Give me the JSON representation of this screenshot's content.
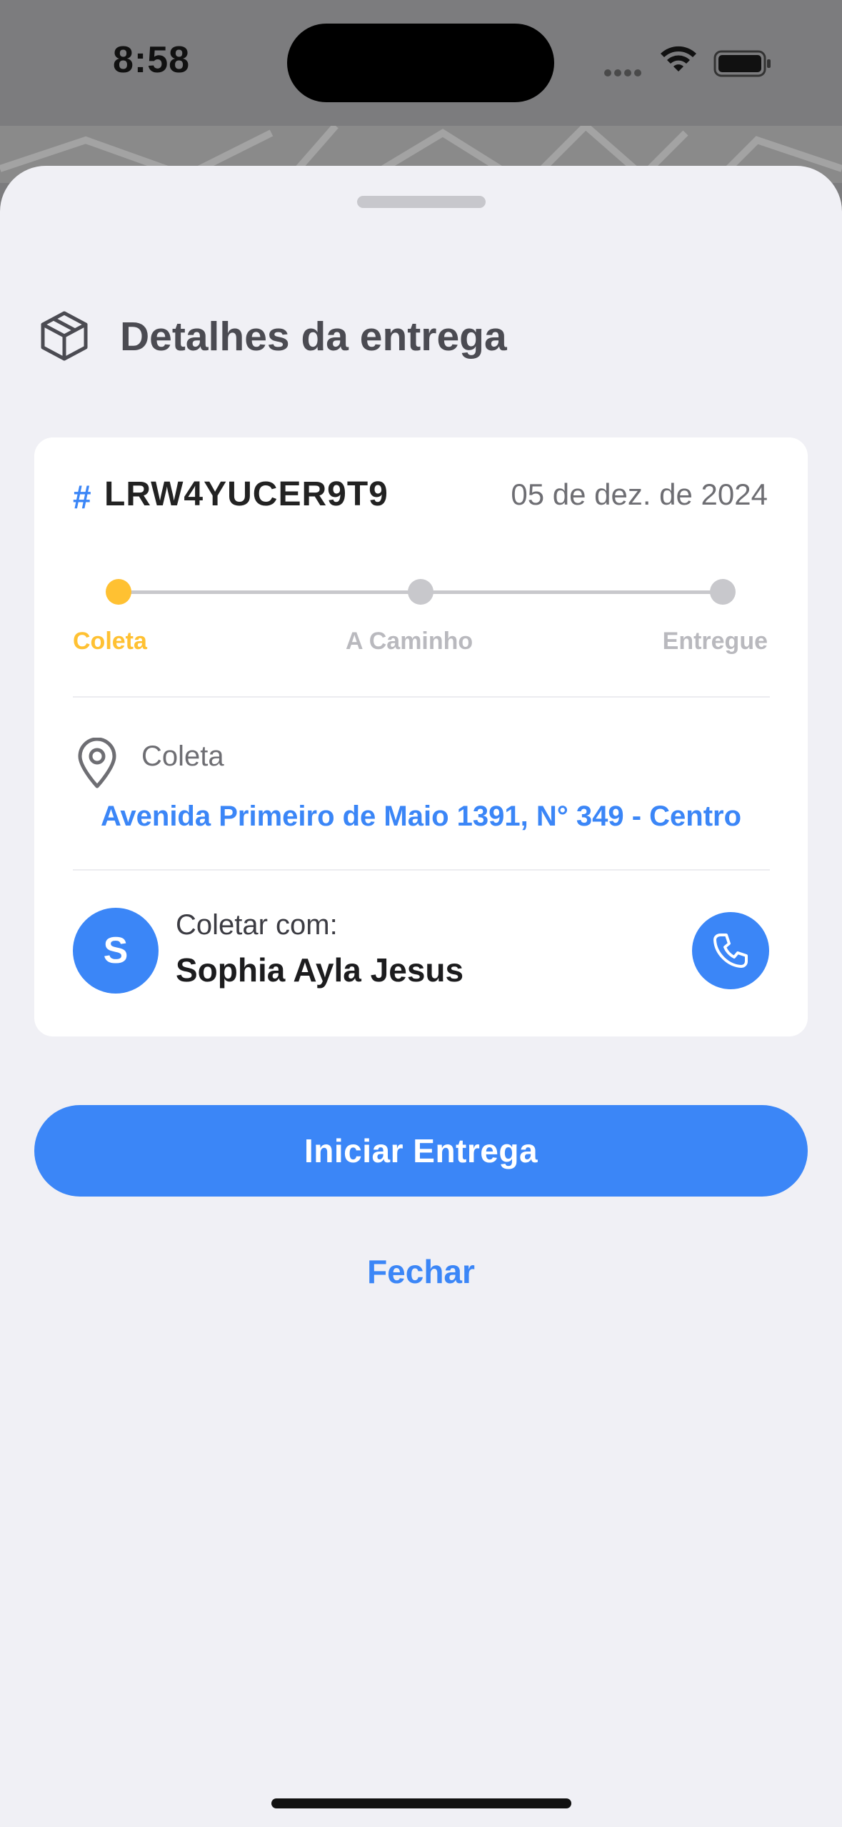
{
  "status_bar": {
    "time": "8:58",
    "wifi_icon": "wifi-icon",
    "battery_icon": "battery-icon"
  },
  "sheet": {
    "title": "Detalhes da entrega",
    "title_icon": "package-icon"
  },
  "order": {
    "hash_symbol": "#",
    "code": "LRW4YUCER9T9",
    "date": "05 de dez. de 2024"
  },
  "progress": {
    "steps": [
      {
        "label": "Coleta",
        "active": true
      },
      {
        "label": "A Caminho",
        "active": false
      },
      {
        "label": "Entregue",
        "active": false
      }
    ],
    "active_color": "#FFC132",
    "inactive_color": "#C8C8CC"
  },
  "pickup": {
    "icon": "map-pin-icon",
    "label": "Coleta",
    "address": "Avenida Primeiro de Maio 1391, N° 349 - Centro"
  },
  "contact": {
    "avatar_initial": "S",
    "caption": "Coletar com:",
    "name": "Sophia Ayla Jesus",
    "call_icon": "phone-icon"
  },
  "actions": {
    "primary_label": "Iniciar Entrega",
    "close_label": "Fechar"
  },
  "colors": {
    "accent": "#3B86F7",
    "sheet_background": "#F0F0F5"
  }
}
